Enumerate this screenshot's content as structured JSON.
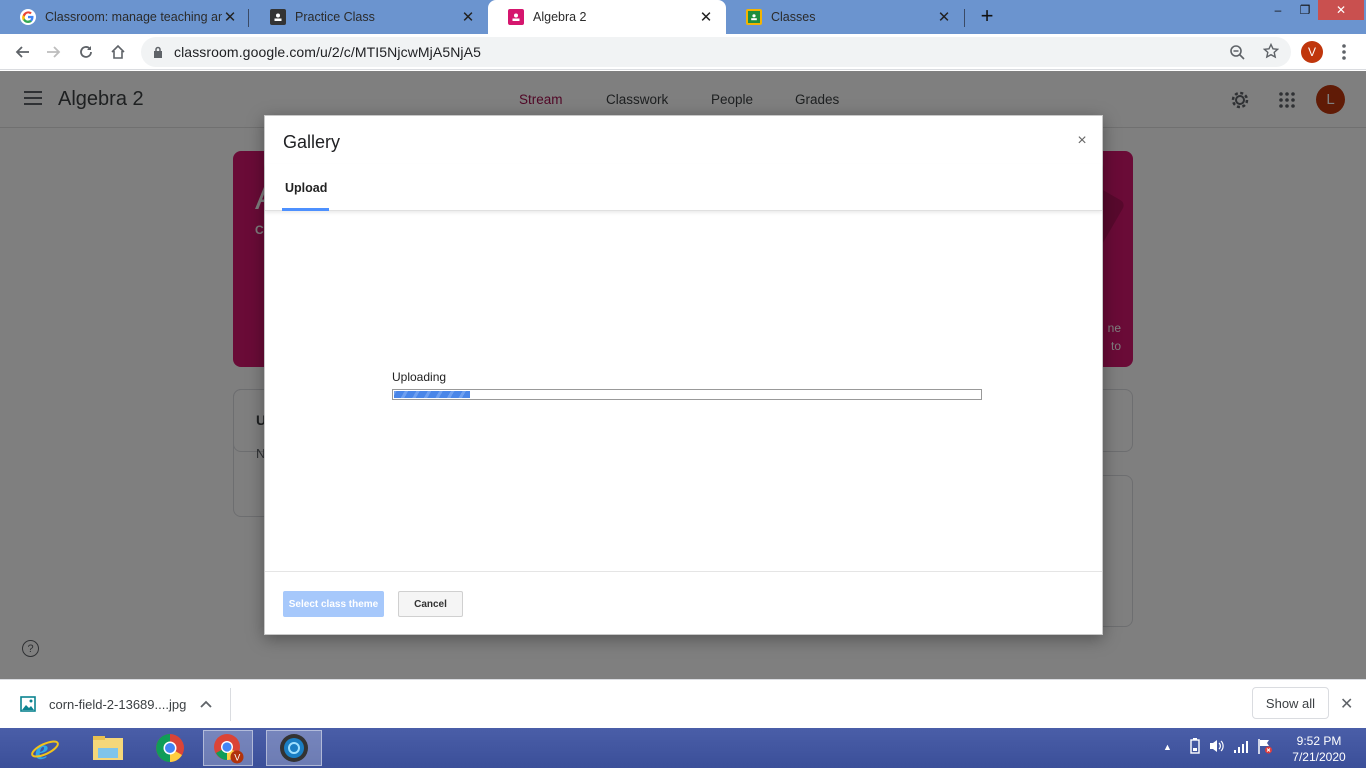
{
  "browser": {
    "tabs": [
      {
        "label": "Classroom: manage teaching and",
        "icon": "google-g-icon",
        "active": false
      },
      {
        "label": "Practice Class",
        "icon": "classroom-icon",
        "active": false
      },
      {
        "label": "Algebra 2",
        "icon": "classroom-pink-icon",
        "active": true
      },
      {
        "label": "Classes",
        "icon": "classroom-green-icon",
        "active": false
      }
    ],
    "new_tab": "+",
    "url": "classroom.google.com/u/2/c/MTI5NjcwMjA5NjA5",
    "profile_initial": "V",
    "window_controls": {
      "minimize": "–",
      "restore": "❐",
      "close": "✕"
    }
  },
  "app": {
    "class_name": "Algebra 2",
    "nav_tabs": [
      {
        "label": "Stream",
        "active": true
      },
      {
        "label": "Classwork",
        "active": false
      },
      {
        "label": "People",
        "active": false
      },
      {
        "label": "Grades",
        "active": false
      }
    ],
    "account_initial": "L",
    "banner": {
      "title": "A",
      "subtitle": "C",
      "side_text_1": "ne",
      "side_text_2": "to"
    },
    "card_upcoming_initial": "U",
    "card_note_initial": "N",
    "help": "?"
  },
  "dialog": {
    "title": "Gallery",
    "close": "×",
    "tab": "Upload",
    "status": "Uploading",
    "progress_percent": 13,
    "primary_button": "Select class theme",
    "cancel_button": "Cancel"
  },
  "downloads": {
    "file_name": "corn-field-2-13689....jpg",
    "chevron": "^",
    "show_all": "Show all",
    "close": "✕"
  },
  "taskbar": {
    "apps": [
      "internet-explorer",
      "file-explorer",
      "chrome",
      "chrome-profile-v",
      "media-app"
    ],
    "tray_up": "▲",
    "time": "9:52 PM",
    "date": "7/21/2020"
  }
}
